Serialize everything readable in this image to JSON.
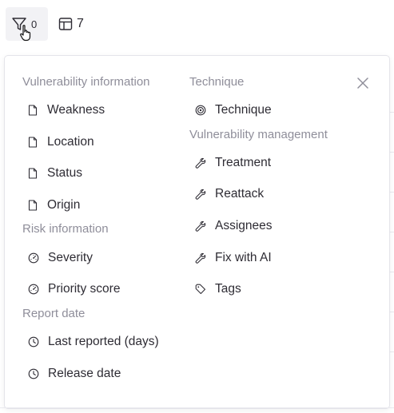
{
  "toolbar": {
    "filter_count": "0",
    "columns_count": "7"
  },
  "panel": {
    "col1": {
      "vuln_info_title": "Vulnerability information",
      "weakness": "Weakness",
      "location": "Location",
      "status": "Status",
      "origin": "Origin",
      "risk_info_title": "Risk information",
      "severity": "Severity",
      "priority_score": "Priority score",
      "report_date_title": "Report date",
      "last_reported": "Last reported (days)",
      "release_date": "Release date"
    },
    "col2": {
      "technique_title": "Technique",
      "technique": "Technique",
      "vuln_mgmt_title": "Vulnerability management",
      "treatment": "Treatment",
      "reattack": "Reattack",
      "assignees": "Assignees",
      "fix_with_ai": "Fix with AI",
      "tags": "Tags"
    }
  },
  "icons": {
    "document": "file-icon",
    "gauge": "gauge-icon",
    "clock": "clock-icon",
    "target": "target-icon",
    "wrench": "wrench-icon",
    "tag": "tag-icon",
    "filter": "filter-icon",
    "table": "table-columns-icon",
    "close": "close-icon"
  }
}
